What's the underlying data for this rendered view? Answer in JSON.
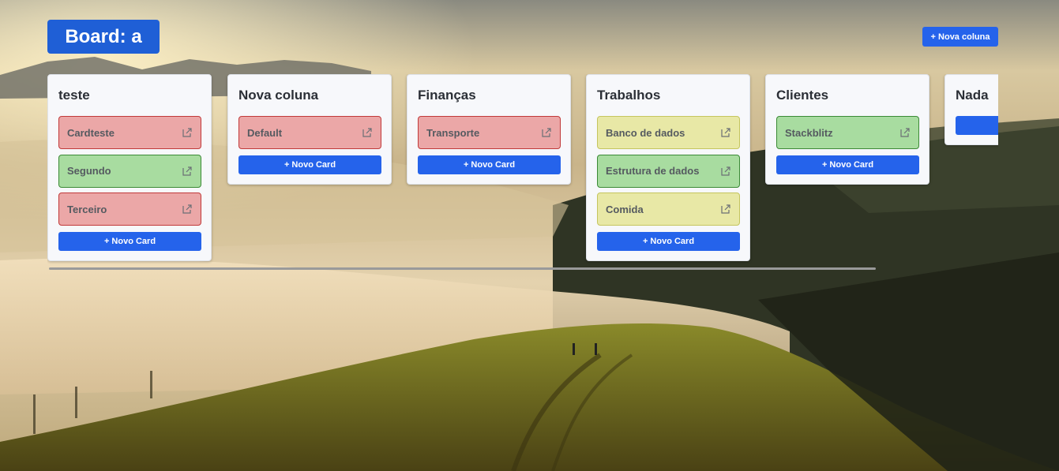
{
  "board": {
    "title": "Board: a",
    "new_column_label": "+ Nova coluna",
    "new_card_label": "+ Novo Card"
  },
  "columns": [
    {
      "title": "teste",
      "cards": [
        {
          "label": "Cardteste",
          "color": "red"
        },
        {
          "label": "Segundo",
          "color": "green"
        },
        {
          "label": "Terceiro",
          "color": "red"
        }
      ]
    },
    {
      "title": "Nova coluna",
      "cards": [
        {
          "label": "Default",
          "color": "red"
        }
      ]
    },
    {
      "title": "Finanças",
      "cards": [
        {
          "label": "Transporte",
          "color": "red"
        }
      ]
    },
    {
      "title": "Trabalhos",
      "cards": [
        {
          "label": "Banco de dados",
          "color": "yellow"
        },
        {
          "label": "Estrutura de dados",
          "color": "green"
        },
        {
          "label": "Comida",
          "color": "yellow"
        }
      ]
    },
    {
      "title": "Clientes",
      "cards": [
        {
          "label": "Stackblitz",
          "color": "green"
        }
      ]
    },
    {
      "title": "Nada",
      "cards": []
    }
  ],
  "icons": {
    "card_open": "external-link-icon"
  },
  "colors": {
    "primary": "#2563eb",
    "title_badge": "#1f5fd6",
    "card_red": "#eba7a7",
    "card_green": "#a8dca0",
    "card_yellow": "#e8e8a6"
  }
}
